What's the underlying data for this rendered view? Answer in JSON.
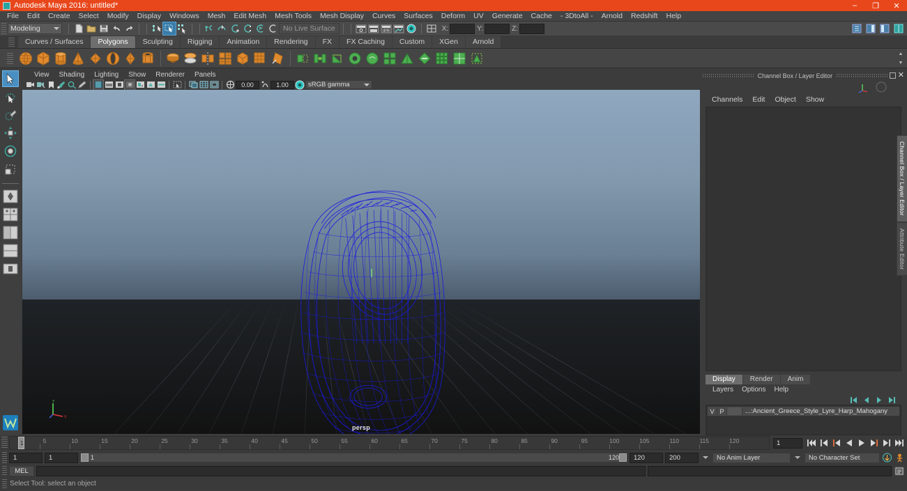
{
  "window": {
    "title": "Autodesk Maya 2016: untitled*",
    "accent": "#e8471c",
    "minimize": "–",
    "maximize": "❐",
    "close": "✕"
  },
  "menubar": {
    "items": [
      "File",
      "Edit",
      "Create",
      "Select",
      "Modify",
      "Display",
      "Windows",
      "Mesh",
      "Edit Mesh",
      "Mesh Tools",
      "Mesh Display",
      "Curves",
      "Surfaces",
      "Deform",
      "UV",
      "Generate",
      "Cache",
      "- 3DtoAll -",
      "Arnold",
      "Redshift",
      "Help"
    ]
  },
  "statusline": {
    "menuset": "Modeling",
    "live_surface": "No Live Surface",
    "coord_labels": [
      "X:",
      "Y:",
      "Z:"
    ],
    "coord_values": [
      "",
      "",
      ""
    ],
    "icons": [
      "new-scene-icon",
      "open-scene-icon",
      "save-scene-icon",
      "undo-icon",
      "redo-icon",
      "select-hierarchy-icon",
      "select-object-icon",
      "select-component-icon",
      "snap-grid-icon",
      "snap-curve-icon",
      "snap-point-icon",
      "snap-projected-icon",
      "snap-view-plane-icon",
      "make-live-icon",
      "render-view-icon",
      "render-current-frame-icon",
      "ipr-render-icon",
      "render-settings-icon",
      "hypershade-icon",
      "toggle-editors-icon"
    ]
  },
  "shelf": {
    "tabs": [
      "Curves / Surfaces",
      "Polygons",
      "Sculpting",
      "Rigging",
      "Animation",
      "Rendering",
      "FX",
      "FX Caching",
      "Custom",
      "XGen",
      "Arnold"
    ],
    "selected_tab": "Polygons",
    "icons": [
      "poly-sphere-icon",
      "poly-cube-icon",
      "poly-cylinder-icon",
      "poly-cone-icon",
      "poly-plane-icon",
      "poly-torus-icon",
      "poly-prism-icon",
      "poly-pipe-icon",
      "poly-combine-icon",
      "poly-booleans-icon",
      "poly-mirror-icon",
      "poly-smooth-icon",
      "poly-extrude-icon",
      "poly-multicut-icon",
      "poly-bevel-icon",
      "poly-bridge-icon",
      "poly-append-icon",
      "poly-wedge-icon",
      "poly-fill-hole-icon",
      "poly-sculpt-icon",
      "poly-quadrangulate-icon",
      "poly-triangulate-icon",
      "poly-reduce-icon",
      "uv-editor-icon",
      "uv-planar-icon",
      "uv-unfold-icon"
    ]
  },
  "toolbox": {
    "tools": [
      {
        "name": "select-tool",
        "selected": true
      },
      {
        "name": "lasso-select-tool",
        "selected": false
      },
      {
        "name": "paint-select-tool",
        "selected": false
      },
      {
        "name": "move-tool",
        "selected": false
      },
      {
        "name": "rotate-tool",
        "selected": false
      },
      {
        "name": "scale-tool",
        "selected": false
      },
      {
        "name": "last-tool-used",
        "selected": false
      }
    ],
    "layouts": [
      "single-perspective-layout",
      "four-view-layout",
      "two-pane-side-layout",
      "two-pane-stacked-layout",
      "outliner-persp-layout"
    ],
    "bottom_icon": "maya-logo-icon"
  },
  "viewport": {
    "menus": [
      "View",
      "Shading",
      "Lighting",
      "Show",
      "Renderer",
      "Panels"
    ],
    "camera_label": "persp",
    "exposure": "0.00",
    "gamma": "1.00",
    "color_management": "sRGB gamma",
    "toolbar_icons": [
      "select-camera-icon",
      "camera-attributes-icon",
      "bookmark-icon",
      "image-plane-icon",
      "2d-pan-zoom-icon",
      "grease-pencil-icon",
      "wireframe-icon",
      "smooth-shade-icon",
      "shaded-textured-icon",
      "use-default-light-icon",
      "shadows-icon",
      "screen-space-ao-icon",
      "motion-blur-icon",
      "multisample-icon",
      "xray-icon",
      "xray-joints-icon",
      "isolate-select-icon",
      "grid-toggle-icon",
      "film-gate-icon",
      "resolution-gate-icon",
      "gate-mask-icon",
      "exposure-icon",
      "gamma-icon",
      "color-management-icon"
    ],
    "model": {
      "name": "Ancient Greece Style Lyre Harp",
      "wireframe_color": "#1a1ae0",
      "background_top": "#8fa8c0",
      "background_bottom": "#141414"
    }
  },
  "channelbox": {
    "panel_title": "Channel Box / Layer Editor",
    "menus": [
      "Channels",
      "Edit",
      "Object",
      "Show"
    ],
    "body_text": ""
  },
  "layer_editor": {
    "tabs": [
      "Display",
      "Render",
      "Anim"
    ],
    "selected_tab": "Display",
    "menus": [
      "Layers",
      "Options",
      "Help"
    ],
    "buttons": [
      "layer-first-icon",
      "layer-prev-icon",
      "layer-next-icon",
      "layer-last-icon"
    ],
    "rows": [
      {
        "visible": "V",
        "playback": "P",
        "name": "...:Ancient_Greece_Style_Lyre_Harp_Mahogany"
      }
    ]
  },
  "right_tabs": {
    "items": [
      "Channel Box / Layer Editor",
      "Attribute Editor"
    ],
    "selected": "Channel Box / Layer Editor"
  },
  "timeline": {
    "tick_labels": [
      "5",
      "10",
      "15",
      "20",
      "25",
      "30",
      "35",
      "40",
      "45",
      "50",
      "55",
      "60",
      "65",
      "70",
      "75",
      "80",
      "85",
      "90",
      "95",
      "100",
      "105",
      "110",
      "115",
      "120"
    ],
    "current_frame": "1",
    "current_frame_field": "1",
    "playback_buttons": [
      "go-to-start-icon",
      "step-back-keyframe-icon",
      "step-back-frame-icon",
      "play-backwards-icon",
      "play-forwards-icon",
      "step-forward-frame-icon",
      "step-forward-keyframe-icon",
      "go-to-end-icon"
    ]
  },
  "range_slider": {
    "anim_start": "1",
    "range_start": "1",
    "bar_start_label": "1",
    "bar_end_label": "120",
    "range_end": "120",
    "anim_end": "200",
    "anim_layer": "No Anim Layer",
    "character_set": "No Character Set",
    "extra_icons": [
      "auto-keyframe-icon",
      "animation-preferences-icon"
    ]
  },
  "command_line": {
    "language_label": "MEL",
    "input_value": "",
    "output_value": "",
    "script_editor_icon": "script-editor-icon"
  },
  "help_line": {
    "text": "Select Tool: select an object"
  }
}
